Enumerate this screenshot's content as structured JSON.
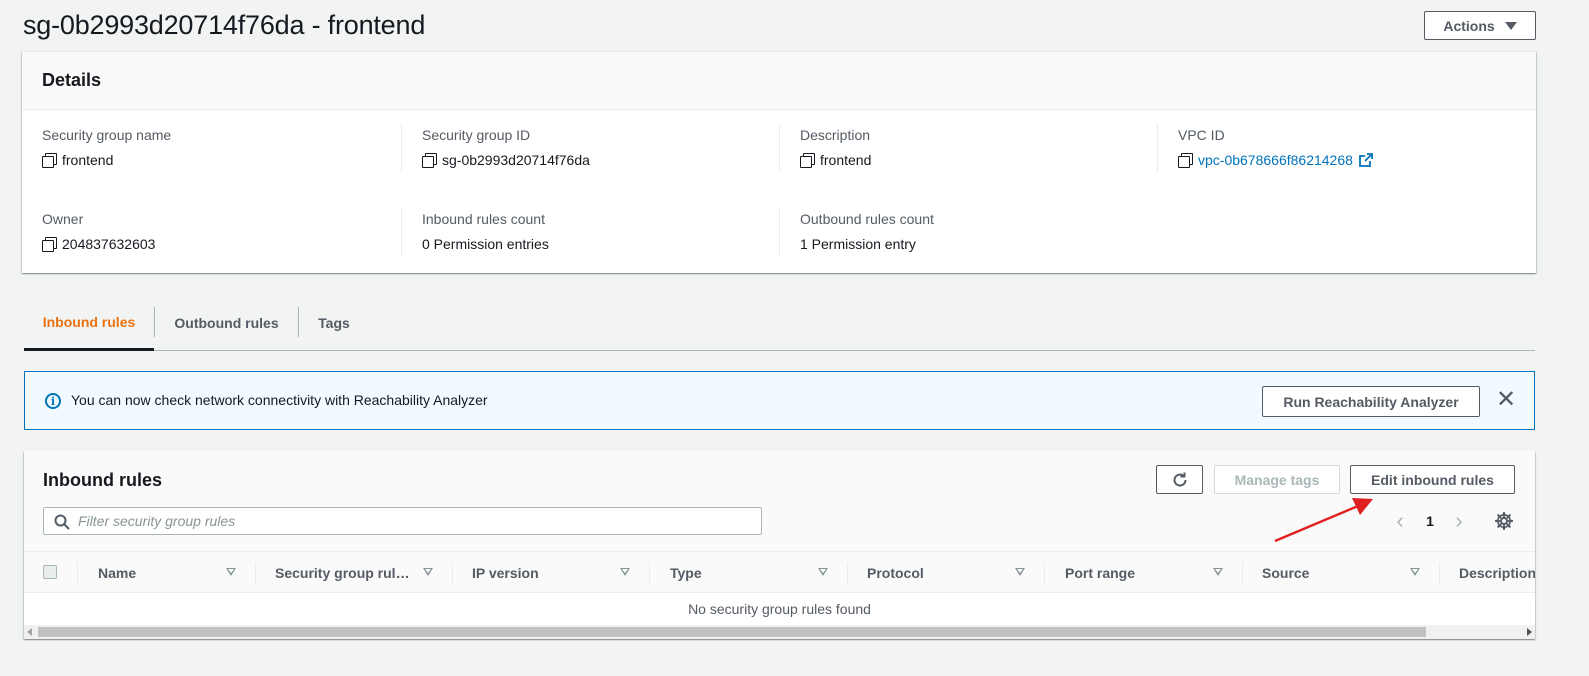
{
  "header": {
    "title": "sg-0b2993d20714f76da - frontend",
    "actions_label": "Actions"
  },
  "details": {
    "title": "Details",
    "fields": [
      {
        "label": "Security group name",
        "value": "frontend",
        "copyable": true,
        "link": false
      },
      {
        "label": "Security group ID",
        "value": "sg-0b2993d20714f76da",
        "copyable": true,
        "link": false
      },
      {
        "label": "Description",
        "value": "frontend",
        "copyable": true,
        "link": false
      },
      {
        "label": "VPC ID",
        "value": "vpc-0b678666f86214268",
        "copyable": true,
        "link": true
      },
      {
        "label": "Owner",
        "value": "204837632603",
        "copyable": true,
        "link": false
      },
      {
        "label": "Inbound rules count",
        "value": "0 Permission entries",
        "copyable": false,
        "link": false
      },
      {
        "label": "Outbound rules count",
        "value": "1 Permission entry",
        "copyable": false,
        "link": false
      }
    ]
  },
  "tabs": [
    {
      "label": "Inbound rules",
      "active": true
    },
    {
      "label": "Outbound rules",
      "active": false
    },
    {
      "label": "Tags",
      "active": false
    }
  ],
  "flash": {
    "message": "You can now check network connectivity with Reachability Analyzer",
    "button_label": "Run Reachability Analyzer",
    "close_glyph": "✕"
  },
  "rules_panel": {
    "title": "Inbound rules",
    "manage_tags_label": "Manage tags",
    "edit_label": "Edit inbound rules",
    "search_placeholder": "Filter security group rules",
    "page_number": "1",
    "columns": [
      "Name",
      "Security group rule...",
      "IP version",
      "Type",
      "Protocol",
      "Port range",
      "Source",
      "Description"
    ],
    "empty_message": "No security group rules found"
  },
  "colors": {
    "accent": "#ec7211",
    "link": "#0073bb",
    "annotation": "#e02020"
  }
}
